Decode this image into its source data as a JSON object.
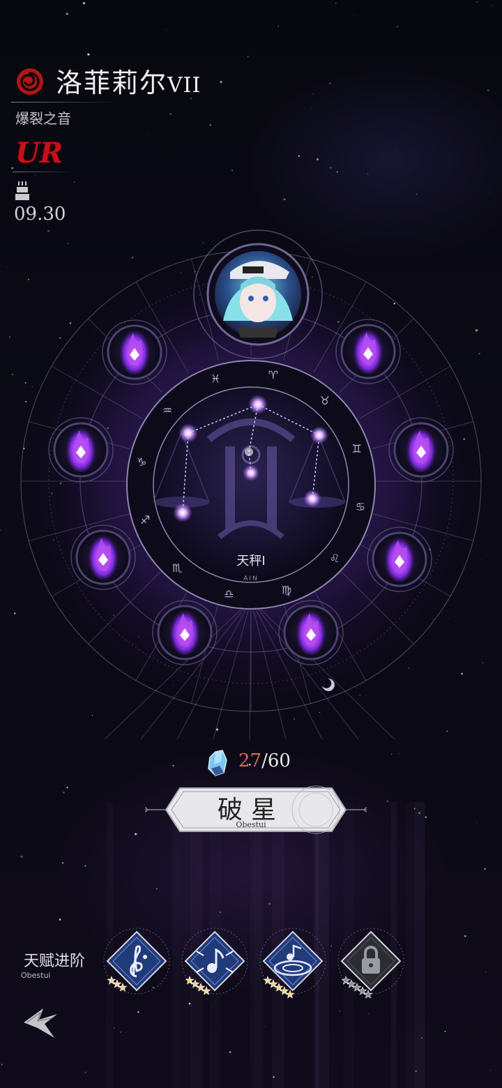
{
  "character": {
    "name": "洛菲莉尔",
    "rank": "VII",
    "subtitle": "爆裂之音",
    "rarity": "UR",
    "birthday": "09.30"
  },
  "constellation": {
    "name": "天秤Ⅰ",
    "sub": "AIN"
  },
  "cost": {
    "current": "27",
    "separator": "/",
    "total": "60"
  },
  "breakthrough_button": {
    "label": "破星",
    "sub": "Obestui"
  },
  "talent": {
    "title": "天赋进阶",
    "sub": "Obestui",
    "items": [
      {
        "icon": "treble-clef-icon",
        "stars": 3,
        "locked": false
      },
      {
        "icon": "music-note-burst-icon",
        "stars": 4,
        "locked": false
      },
      {
        "icon": "music-note-ripple-icon",
        "stars": 5,
        "locked": false
      },
      {
        "icon": "lock-icon",
        "stars": 5,
        "locked": true
      }
    ]
  },
  "colors": {
    "accent_purple": "#9b5cff",
    "rarity_red": "#c8101c",
    "cost_red": "#e06a55"
  }
}
